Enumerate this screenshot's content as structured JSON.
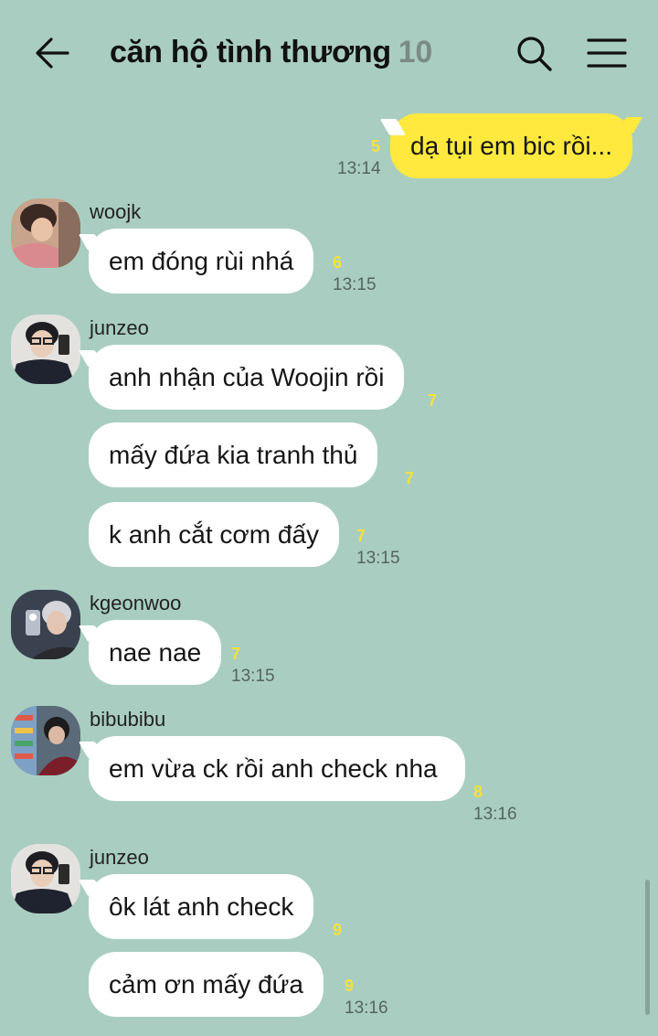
{
  "header": {
    "title": "căn hộ tình thương",
    "member_count": "10",
    "back_icon": "arrow-left-icon",
    "search_icon": "search-icon",
    "menu_icon": "hamburger-menu-icon"
  },
  "colors": {
    "background": "#a9cec1",
    "my_bubble": "#ffe93e",
    "other_bubble": "#ffffff",
    "unread": "#f6e13a"
  },
  "messages": [
    {
      "mine": true,
      "text": "dạ tụi em bic rồi...",
      "unread": "5",
      "time": "13:14"
    },
    {
      "sender": "woojk",
      "text": "em đóng rùi nhá",
      "unread": "6",
      "time": "13:15"
    },
    {
      "sender": "junzeo",
      "text": "anh nhận của Woojin rồi",
      "unread": "7"
    },
    {
      "text": "mấy đứa kia tranh thủ",
      "unread": "7"
    },
    {
      "text": "k anh cắt cơm đấy",
      "unread": "7",
      "time": "13:15"
    },
    {
      "sender": "kgeonwoo",
      "text": "nae nae",
      "unread": "7",
      "time": "13:15"
    },
    {
      "sender": "bibubibu",
      "text": "em vừa ck rồi anh check nha",
      "unread": "8",
      "time": "13:16"
    },
    {
      "sender": "junzeo",
      "text": "ôk lát anh check",
      "unread": "9"
    },
    {
      "text": "cảm ơn mấy đứa",
      "unread": "9",
      "time": "13:16"
    }
  ]
}
